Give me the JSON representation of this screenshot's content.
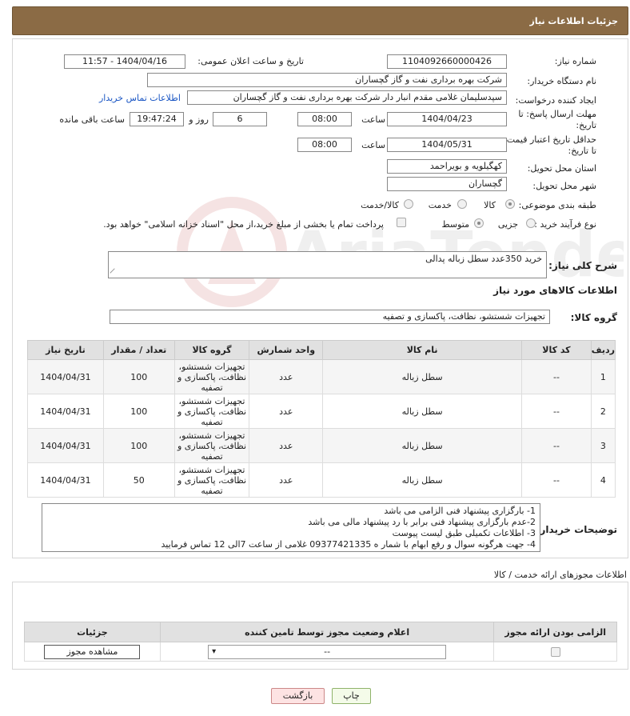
{
  "header": {
    "title": "جزئیات اطلاعات نیاز"
  },
  "form": {
    "need_number_label": "شماره نیاز:",
    "need_number": "1104092660000426",
    "announce_label": "تاریخ و ساعت اعلان عمومی:",
    "announce_value": "1404/04/16 - 11:57",
    "buyer_org_label": "نام دستگاه خریدار:",
    "buyer_org": "شرکت بهره برداری نفت و گاز گچساران",
    "creator_label": "ایجاد کننده درخواست:",
    "creator": "سپدسلیمان غلامی مقدم انبار دار شرکت بهره برداری نفت و گاز گچساران",
    "contact_link": "اطلاعات تماس خریدار",
    "reply_deadline_label_1": "مهلت ارسال پاسخ: تا",
    "reply_deadline_label_2": "تاریخ:",
    "reply_date": "1404/04/23",
    "time_label": "ساعت",
    "reply_time": "08:00",
    "days_value": "6",
    "days_label": "روز و",
    "remaining_time": "19:47:24",
    "remaining_label": "ساعت باقی مانده",
    "price_validity_label_1": "حداقل تاریخ اعتبار قیمت:",
    "price_validity_label_2": "تا تاریخ:",
    "price_date": "1404/05/31",
    "price_time": "08:00",
    "province_label": "استان محل تحویل:",
    "province": "کهگیلویه و بویراحمد",
    "city_label": "شهر محل تحویل:",
    "city": "گچساران",
    "category_label": "طبقه بندی موضوعی:",
    "category_options": [
      "کالا",
      "خدمت",
      "کالا/خدمت"
    ],
    "purchase_type_label": "نوع فرآیند خرید :",
    "purchase_options": [
      "جزیی",
      "متوسط"
    ],
    "payment_note": "پرداخت تمام یا بخشی از مبلغ خرید،از محل \"اسناد خزانه اسلامی\" خواهد بود.",
    "description_label": "شرح کلی نیاز:",
    "description": "خرید 350عدد سطل زباله پدالی",
    "goods_info_title": "اطلاعات کالاهای مورد نیاز",
    "goods_group_label": "گروه کالا:",
    "goods_group": "تجهیزات شستشو، نظافت، پاکسازی و تصفیه"
  },
  "table": {
    "headers": [
      "ردیف",
      "کد کالا",
      "نام کالا",
      "واحد شمارش",
      "گروه کالا",
      "تعداد / مقدار",
      "تاریخ نیاز"
    ],
    "rows": [
      {
        "idx": "1",
        "code": "--",
        "name": "سطل زباله",
        "unit": "عدد",
        "group": "تجهیزات شستشو، نظافت، پاکسازی و تصفیه",
        "qty": "100",
        "date": "1404/04/31"
      },
      {
        "idx": "2",
        "code": "--",
        "name": "سطل زباله",
        "unit": "عدد",
        "group": "تجهیزات شستشو، نظافت، پاکسازی و تصفیه",
        "qty": "100",
        "date": "1404/04/31"
      },
      {
        "idx": "3",
        "code": "--",
        "name": "سطل زباله",
        "unit": "عدد",
        "group": "تجهیزات شستشو، نظافت، پاکسازی و تصفیه",
        "qty": "100",
        "date": "1404/04/31"
      },
      {
        "idx": "4",
        "code": "--",
        "name": "سطل زباله",
        "unit": "عدد",
        "group": "تجهیزات شستشو، نظافت، پاکسازی و تصفیه",
        "qty": "50",
        "date": "1404/04/31"
      }
    ]
  },
  "notes": {
    "label": "توضیحات خریدار:",
    "lines": [
      "1- بارگزاری پیشنهاد فنی الزامی می باشد",
      "2-عدم بارگزاری پیشنهاد فنی برابر با رد پیشنهاد مالی می باشد",
      "3- اطلاعات تکمیلی طبق لیست پیوست",
      "4- جهت هرگونه سوال و رفع ابهام با شمار ه 09377421335 غلامی از ساعت 7الی 12 تماس فرمایید"
    ]
  },
  "license": {
    "title": "اطلاعات مجوزهای ارائه خدمت / کالا",
    "headers": [
      "الزامی بودن ارائه مجوز",
      "اعلام وضعیت مجوز توسط تامین کننده",
      "جزئیات"
    ],
    "status_value": "--",
    "view_button": "مشاهده مجوز"
  },
  "buttons": {
    "print": "چاپ",
    "back": "بازگشت"
  },
  "watermark": {
    "text": "AriaTender.neT"
  }
}
